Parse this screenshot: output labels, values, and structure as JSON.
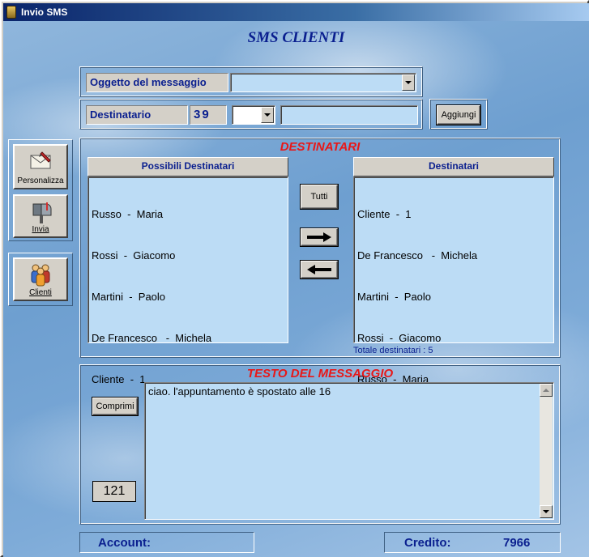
{
  "window": {
    "title": "Invio SMS"
  },
  "header": {
    "title": "SMS CLIENTI"
  },
  "form": {
    "oggetto_label": "Oggetto del messaggio",
    "oggetto_value": "",
    "destinatario_label": "Destinatario",
    "prefisso": "39",
    "operatore_value": "",
    "numero_value": "",
    "aggiungi_label": "Aggiungi"
  },
  "sidebar": {
    "personalizza_label": "Personalizza",
    "invia_label": "Invia",
    "clienti_label": "Clienti"
  },
  "destinatari": {
    "title": "DESTINATARI",
    "possibili_header": "Possibili Destinatari",
    "possibili": [
      "Russo  -  Maria",
      "Rossi  -  Giacomo",
      "Martini  -  Paolo",
      "De Francesco   -  Michela",
      "Cliente  -  1"
    ],
    "selezionati_header": "Destinatari",
    "selezionati": [
      "Cliente  -  1",
      "De Francesco   -  Michela",
      "Martini  -  Paolo",
      "Rossi  -  Giacomo",
      "Russo  -  Maria"
    ],
    "tutti_label": "Tutti",
    "totale_text": "Totale destinatari : 5"
  },
  "messaggio": {
    "title": "TESTO DEL MESSAGGIO",
    "comprimi_label": "Comprimi",
    "testo": "ciao. l'appuntamento è spostato alle 16",
    "caratteri_rimanenti": "121"
  },
  "status": {
    "account_label": "Account:",
    "account_value": "",
    "credito_label": "Credito:",
    "credito_value": "7966"
  },
  "colors": {
    "title_blue": "#0a1f8f",
    "section_red": "#e81818",
    "field_blue": "#bcdcf5"
  }
}
